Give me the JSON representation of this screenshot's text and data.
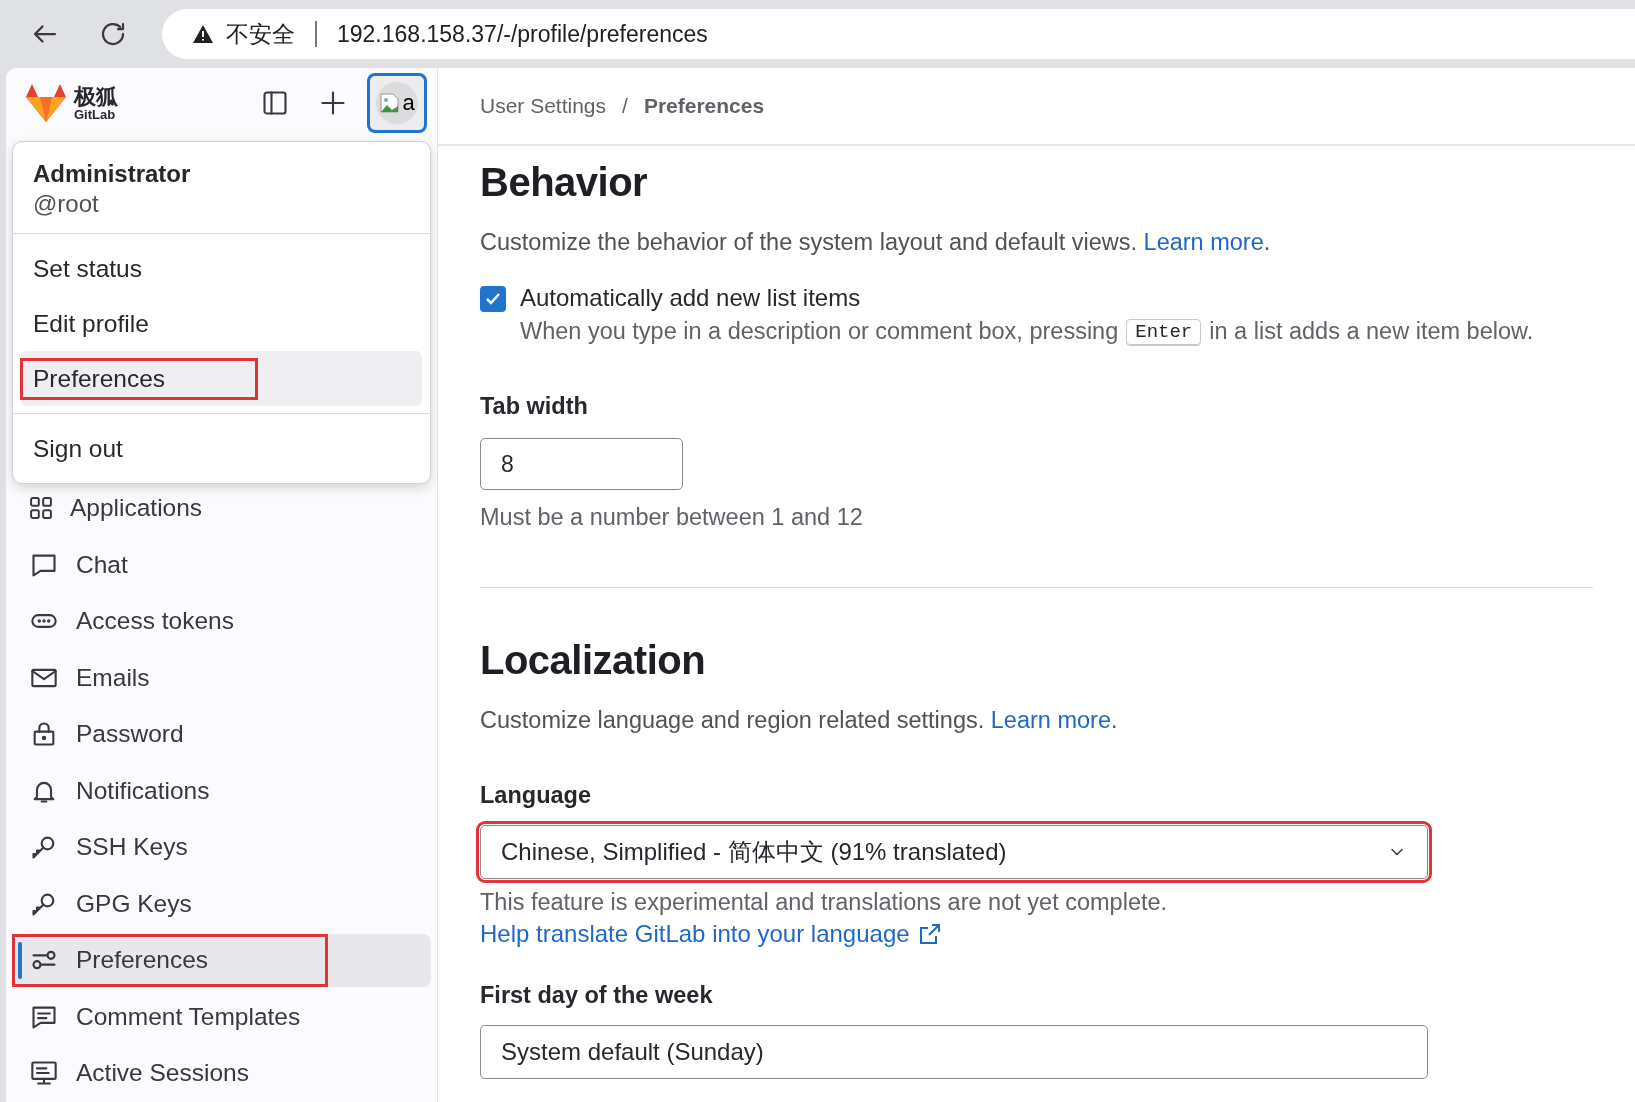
{
  "browser": {
    "security_label": "不安全",
    "url": "192.168.158.37/-/profile/preferences"
  },
  "brand": {
    "name": "极狐",
    "subtitle": "GitLab"
  },
  "avatar": {
    "alt": "a",
    "selected": true
  },
  "user_menu": {
    "name": "Administrator",
    "username": "@root",
    "items": [
      {
        "label": "Set status",
        "selected": false,
        "highlighted": false
      },
      {
        "label": "Edit profile",
        "selected": false,
        "highlighted": false
      },
      {
        "label": "Preferences",
        "selected": true,
        "highlighted": true
      }
    ],
    "sign_out": "Sign out"
  },
  "sidebar": {
    "items": [
      {
        "kind": "applications",
        "label": "Applications",
        "selected": false,
        "highlighted": false
      },
      {
        "kind": "chat",
        "label": "Chat",
        "selected": false,
        "highlighted": false
      },
      {
        "kind": "token",
        "label": "Access tokens",
        "selected": false,
        "highlighted": false
      },
      {
        "kind": "email",
        "label": "Emails",
        "selected": false,
        "highlighted": false
      },
      {
        "kind": "password",
        "label": "Password",
        "selected": false,
        "highlighted": false
      },
      {
        "kind": "notifications",
        "label": "Notifications",
        "selected": false,
        "highlighted": false
      },
      {
        "kind": "key",
        "label": "SSH Keys",
        "selected": false,
        "highlighted": false
      },
      {
        "kind": "key",
        "label": "GPG Keys",
        "selected": false,
        "highlighted": false
      },
      {
        "kind": "preferences",
        "label": "Preferences",
        "selected": true,
        "highlighted": true
      },
      {
        "kind": "comment",
        "label": "Comment Templates",
        "selected": false,
        "highlighted": false
      },
      {
        "kind": "sessions",
        "label": "Active Sessions",
        "selected": false,
        "highlighted": false
      }
    ]
  },
  "breadcrumb": [
    {
      "label": "User Settings",
      "current": false
    },
    {
      "separator": "/",
      "label": "Preferences",
      "current": true
    }
  ],
  "behavior": {
    "title": "Behavior",
    "description": "Customize the behavior of the system layout and default views. ",
    "link": "Learn more",
    "after_link": ".",
    "checkbox": {
      "label": "Automatically add new list items",
      "checked": true,
      "hint_before": "When you type in a description or comment box, pressing ",
      "key": "Enter",
      "hint_after": " in a list adds a new item below."
    },
    "tab_width": {
      "label": "Tab width",
      "value": "8",
      "help": "Must be a number between 1 and 12"
    }
  },
  "localization": {
    "title": "Localization",
    "description": "Customize language and region related settings. ",
    "link": "Learn more",
    "after_link": ".",
    "language": {
      "label": "Language",
      "value": "Chinese, Simplified - 简体中文 (91% translated)",
      "highlighted": true,
      "note": "This feature is experimental and translations are not yet complete.",
      "help_link": "Help translate GitLab into your language"
    },
    "first_day": {
      "label": "First day of the week",
      "value": "System default (Sunday)"
    }
  }
}
